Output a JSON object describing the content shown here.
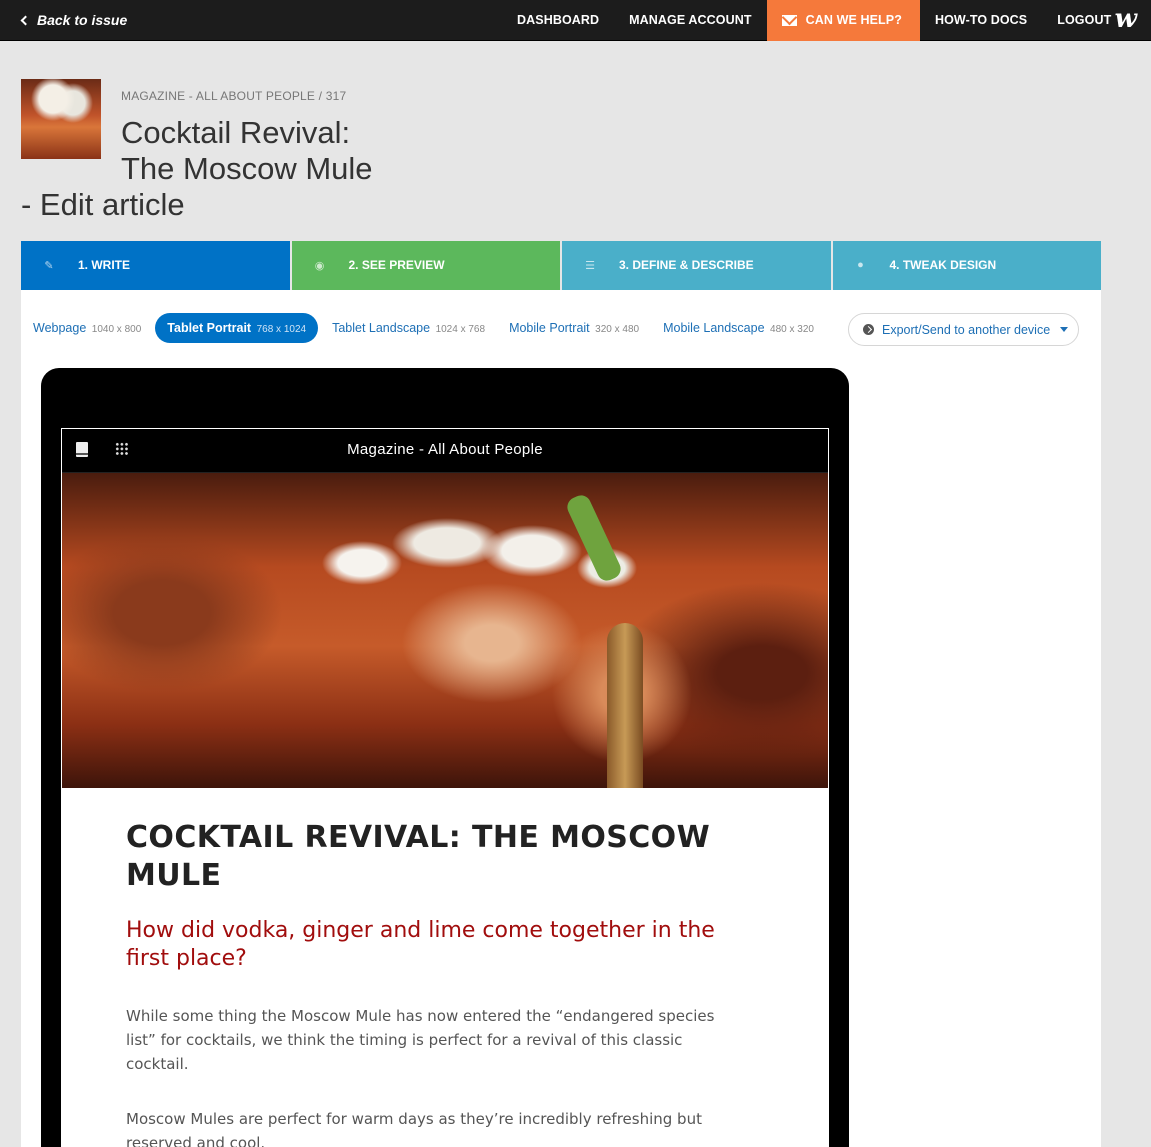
{
  "topbar": {
    "back_label": "Back to issue",
    "nav": [
      "DASHBOARD",
      "MANAGE ACCOUNT",
      "CAN WE HELP?",
      "HOW-TO DOCS",
      "LOGOUT"
    ],
    "logo": "w"
  },
  "header": {
    "breadcrumb": "MAGAZINE - ALL ABOUT PEOPLE / 317",
    "title_line1": "Cocktail Revival:",
    "title_line2": "The Moscow Mule",
    "title_suffix": "- Edit article"
  },
  "steps": [
    {
      "label": "1. WRITE",
      "icon": "pencil-icon",
      "color": "#0072c6"
    },
    {
      "label": "2. SEE PREVIEW",
      "icon": "eye-icon",
      "color": "#5cb85c"
    },
    {
      "label": "3. DEFINE & DESCRIBE",
      "icon": "list-icon",
      "color": "#4aafc9"
    },
    {
      "label": "4. TWEAK DESIGN",
      "icon": "drop-icon",
      "color": "#4aafc9"
    }
  ],
  "devices": [
    {
      "label": "Webpage",
      "size": "1040 x 800"
    },
    {
      "label": "Tablet Portrait",
      "size": "768 x 1024",
      "active": true
    },
    {
      "label": "Tablet Landscape",
      "size": "1024 x 768"
    },
    {
      "label": "Mobile Portrait",
      "size": "320 x 480"
    },
    {
      "label": "Mobile Landscape",
      "size": "480 x 320"
    }
  ],
  "export_label": "Export/Send to another device",
  "preview": {
    "app_title": "Magazine - All About People",
    "headline": "COCKTAIL REVIVAL: THE MOSCOW MULE",
    "subheadline": "How did vodka, ginger and lime come together in the first place?",
    "paragraphs": [
      "While some thing the Moscow Mule has now entered the “endangered species list” for cocktails, we think the timing is perfect for a revival of this classic cocktail.",
      "Moscow Mules are perfect for warm days as they’re incredibly refreshing but reserved and cool."
    ]
  }
}
